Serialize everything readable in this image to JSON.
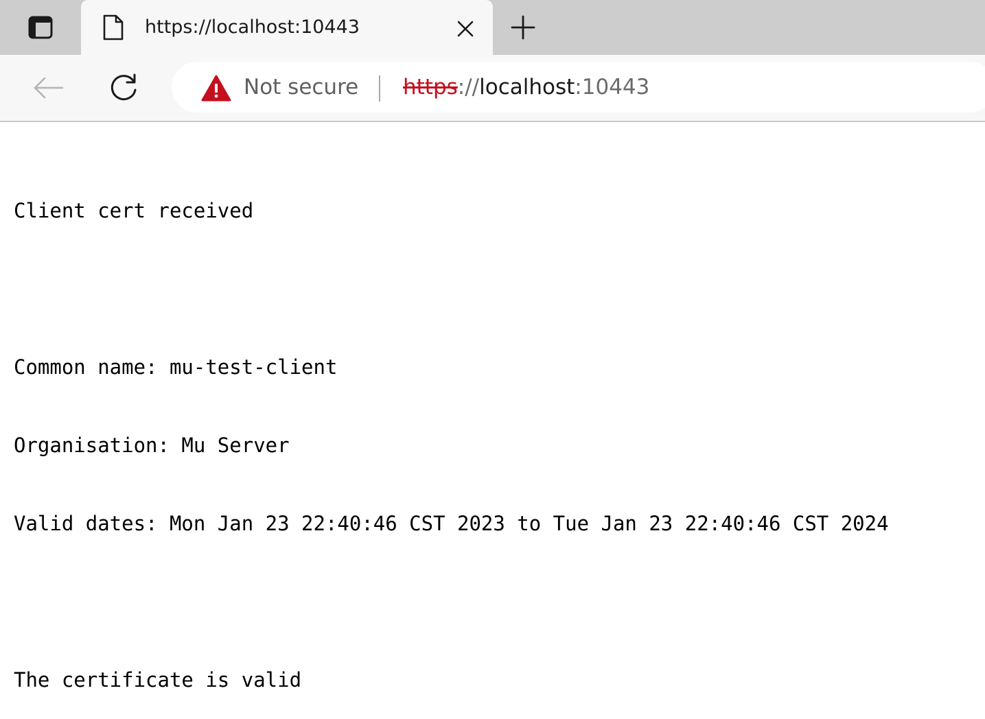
{
  "browser": {
    "tab": {
      "title": "https://localhost:10443",
      "icon": "document-icon"
    },
    "toolbar": {
      "security_label": "Not secure",
      "url": {
        "scheme": "https",
        "separator": "://",
        "host": "localhost",
        "port": ":10443"
      }
    },
    "colors": {
      "tabstrip": "#cdcdcd",
      "toolbar": "#f7f7f7",
      "warning": "#c50f1f"
    }
  },
  "page": {
    "lines": [
      "Client cert received",
      "",
      "Common name: mu-test-client",
      "Organisation: Mu Server",
      "Valid dates: Mon Jan 23 22:40:46 CST 2023 to Tue Jan 23 22:40:46 CST 2024",
      "",
      "The certificate is valid"
    ]
  }
}
